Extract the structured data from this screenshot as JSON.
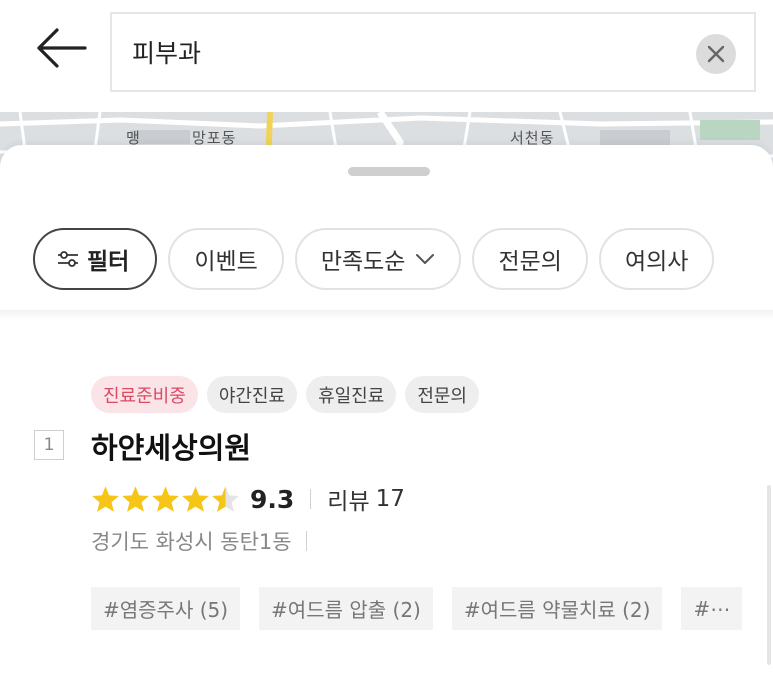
{
  "search": {
    "query": "피부과"
  },
  "map": {
    "labels": [
      "맹",
      "망포동",
      "서천동"
    ]
  },
  "filters": {
    "filter_label": "필터",
    "chips": [
      "이벤트",
      "만족도순",
      "전문의",
      "여의사"
    ]
  },
  "result": {
    "rank": "1",
    "tags": [
      "진료준비중",
      "야간진료",
      "휴일진료",
      "전문의"
    ],
    "name": "하얀세상의원",
    "rating": 9.3,
    "score_text": "9.3",
    "stars": 4.5,
    "reviews_label": "리뷰",
    "reviews_count": "17",
    "address": "경기도 화성시 동탄1동",
    "hashtags": [
      "#염증주사 (5)",
      "#여드름 압출 (2)",
      "#여드름 약물치료 (2)",
      "#⋯"
    ]
  },
  "colors": {
    "star": "#f5c518",
    "preparing_tag_bg": "#fbe4e8",
    "preparing_tag_text": "#d94a63"
  }
}
